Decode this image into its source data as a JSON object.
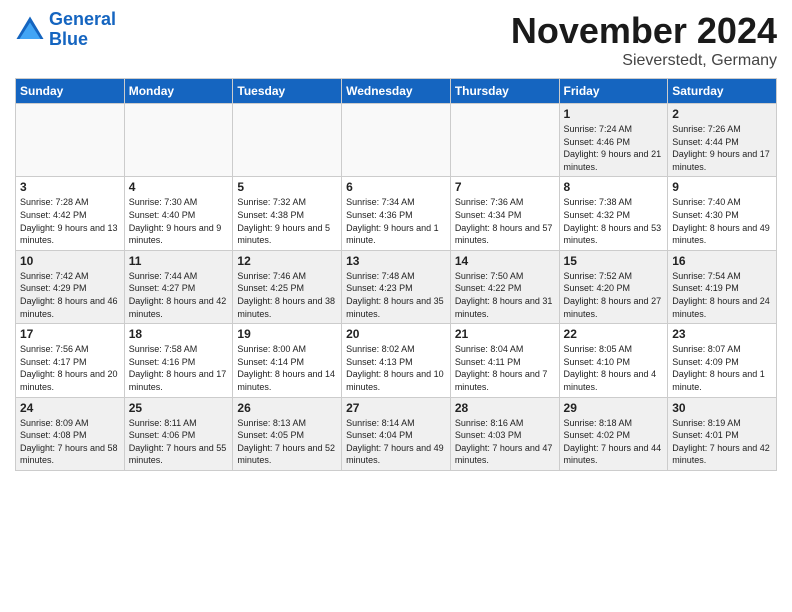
{
  "header": {
    "logo_line1": "General",
    "logo_line2": "Blue",
    "month_title": "November 2024",
    "location": "Sieverstedt, Germany"
  },
  "weekdays": [
    "Sunday",
    "Monday",
    "Tuesday",
    "Wednesday",
    "Thursday",
    "Friday",
    "Saturday"
  ],
  "weeks": [
    [
      {
        "day": "",
        "sunrise": "",
        "sunset": "",
        "daylight": "",
        "empty": true
      },
      {
        "day": "",
        "sunrise": "",
        "sunset": "",
        "daylight": "",
        "empty": true
      },
      {
        "day": "",
        "sunrise": "",
        "sunset": "",
        "daylight": "",
        "empty": true
      },
      {
        "day": "",
        "sunrise": "",
        "sunset": "",
        "daylight": "",
        "empty": true
      },
      {
        "day": "",
        "sunrise": "",
        "sunset": "",
        "daylight": "",
        "empty": true
      },
      {
        "day": "1",
        "sunrise": "Sunrise: 7:24 AM",
        "sunset": "Sunset: 4:46 PM",
        "daylight": "Daylight: 9 hours and 21 minutes."
      },
      {
        "day": "2",
        "sunrise": "Sunrise: 7:26 AM",
        "sunset": "Sunset: 4:44 PM",
        "daylight": "Daylight: 9 hours and 17 minutes."
      }
    ],
    [
      {
        "day": "3",
        "sunrise": "Sunrise: 7:28 AM",
        "sunset": "Sunset: 4:42 PM",
        "daylight": "Daylight: 9 hours and 13 minutes."
      },
      {
        "day": "4",
        "sunrise": "Sunrise: 7:30 AM",
        "sunset": "Sunset: 4:40 PM",
        "daylight": "Daylight: 9 hours and 9 minutes."
      },
      {
        "day": "5",
        "sunrise": "Sunrise: 7:32 AM",
        "sunset": "Sunset: 4:38 PM",
        "daylight": "Daylight: 9 hours and 5 minutes."
      },
      {
        "day": "6",
        "sunrise": "Sunrise: 7:34 AM",
        "sunset": "Sunset: 4:36 PM",
        "daylight": "Daylight: 9 hours and 1 minute."
      },
      {
        "day": "7",
        "sunrise": "Sunrise: 7:36 AM",
        "sunset": "Sunset: 4:34 PM",
        "daylight": "Daylight: 8 hours and 57 minutes."
      },
      {
        "day": "8",
        "sunrise": "Sunrise: 7:38 AM",
        "sunset": "Sunset: 4:32 PM",
        "daylight": "Daylight: 8 hours and 53 minutes."
      },
      {
        "day": "9",
        "sunrise": "Sunrise: 7:40 AM",
        "sunset": "Sunset: 4:30 PM",
        "daylight": "Daylight: 8 hours and 49 minutes."
      }
    ],
    [
      {
        "day": "10",
        "sunrise": "Sunrise: 7:42 AM",
        "sunset": "Sunset: 4:29 PM",
        "daylight": "Daylight: 8 hours and 46 minutes."
      },
      {
        "day": "11",
        "sunrise": "Sunrise: 7:44 AM",
        "sunset": "Sunset: 4:27 PM",
        "daylight": "Daylight: 8 hours and 42 minutes."
      },
      {
        "day": "12",
        "sunrise": "Sunrise: 7:46 AM",
        "sunset": "Sunset: 4:25 PM",
        "daylight": "Daylight: 8 hours and 38 minutes."
      },
      {
        "day": "13",
        "sunrise": "Sunrise: 7:48 AM",
        "sunset": "Sunset: 4:23 PM",
        "daylight": "Daylight: 8 hours and 35 minutes."
      },
      {
        "day": "14",
        "sunrise": "Sunrise: 7:50 AM",
        "sunset": "Sunset: 4:22 PM",
        "daylight": "Daylight: 8 hours and 31 minutes."
      },
      {
        "day": "15",
        "sunrise": "Sunrise: 7:52 AM",
        "sunset": "Sunset: 4:20 PM",
        "daylight": "Daylight: 8 hours and 27 minutes."
      },
      {
        "day": "16",
        "sunrise": "Sunrise: 7:54 AM",
        "sunset": "Sunset: 4:19 PM",
        "daylight": "Daylight: 8 hours and 24 minutes."
      }
    ],
    [
      {
        "day": "17",
        "sunrise": "Sunrise: 7:56 AM",
        "sunset": "Sunset: 4:17 PM",
        "daylight": "Daylight: 8 hours and 20 minutes."
      },
      {
        "day": "18",
        "sunrise": "Sunrise: 7:58 AM",
        "sunset": "Sunset: 4:16 PM",
        "daylight": "Daylight: 8 hours and 17 minutes."
      },
      {
        "day": "19",
        "sunrise": "Sunrise: 8:00 AM",
        "sunset": "Sunset: 4:14 PM",
        "daylight": "Daylight: 8 hours and 14 minutes."
      },
      {
        "day": "20",
        "sunrise": "Sunrise: 8:02 AM",
        "sunset": "Sunset: 4:13 PM",
        "daylight": "Daylight: 8 hours and 10 minutes."
      },
      {
        "day": "21",
        "sunrise": "Sunrise: 8:04 AM",
        "sunset": "Sunset: 4:11 PM",
        "daylight": "Daylight: 8 hours and 7 minutes."
      },
      {
        "day": "22",
        "sunrise": "Sunrise: 8:05 AM",
        "sunset": "Sunset: 4:10 PM",
        "daylight": "Daylight: 8 hours and 4 minutes."
      },
      {
        "day": "23",
        "sunrise": "Sunrise: 8:07 AM",
        "sunset": "Sunset: 4:09 PM",
        "daylight": "Daylight: 8 hours and 1 minute."
      }
    ],
    [
      {
        "day": "24",
        "sunrise": "Sunrise: 8:09 AM",
        "sunset": "Sunset: 4:08 PM",
        "daylight": "Daylight: 7 hours and 58 minutes."
      },
      {
        "day": "25",
        "sunrise": "Sunrise: 8:11 AM",
        "sunset": "Sunset: 4:06 PM",
        "daylight": "Daylight: 7 hours and 55 minutes."
      },
      {
        "day": "26",
        "sunrise": "Sunrise: 8:13 AM",
        "sunset": "Sunset: 4:05 PM",
        "daylight": "Daylight: 7 hours and 52 minutes."
      },
      {
        "day": "27",
        "sunrise": "Sunrise: 8:14 AM",
        "sunset": "Sunset: 4:04 PM",
        "daylight": "Daylight: 7 hours and 49 minutes."
      },
      {
        "day": "28",
        "sunrise": "Sunrise: 8:16 AM",
        "sunset": "Sunset: 4:03 PM",
        "daylight": "Daylight: 7 hours and 47 minutes."
      },
      {
        "day": "29",
        "sunrise": "Sunrise: 8:18 AM",
        "sunset": "Sunset: 4:02 PM",
        "daylight": "Daylight: 7 hours and 44 minutes."
      },
      {
        "day": "30",
        "sunrise": "Sunrise: 8:19 AM",
        "sunset": "Sunset: 4:01 PM",
        "daylight": "Daylight: 7 hours and 42 minutes."
      }
    ]
  ]
}
